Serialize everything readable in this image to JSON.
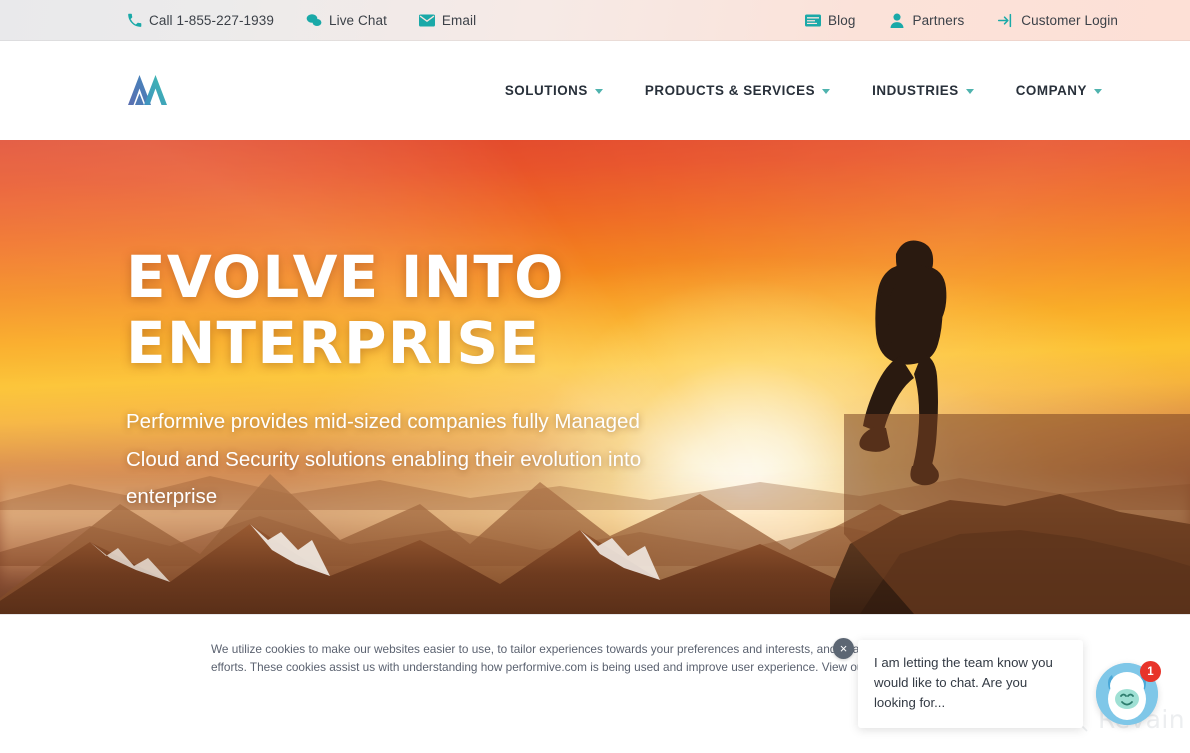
{
  "topbar": {
    "left_items": [
      {
        "icon": "phone-icon",
        "label": "Call 1-855-227-1939"
      },
      {
        "icon": "chat-bubbles-icon",
        "label": "Live Chat"
      },
      {
        "icon": "envelope-icon",
        "label": "Email"
      }
    ],
    "right_items": [
      {
        "icon": "blog-card-icon",
        "label": "Blog"
      },
      {
        "icon": "person-icon",
        "label": "Partners"
      },
      {
        "icon": "login-arrow-icon",
        "label": "Customer Login"
      }
    ],
    "accent_color": "#1aa9a8",
    "background_from": "#e9e9eb",
    "background_to": "#fde0d6"
  },
  "nav": {
    "logo_name": "performive-mountain-logo",
    "logo_colors": {
      "left": "#4a6fb5",
      "right": "#3fb6ad"
    },
    "items": [
      {
        "label": "SOLUTIONS",
        "has_dropdown": true
      },
      {
        "label": "PRODUCTS & SERVICES",
        "has_dropdown": true
      },
      {
        "label": "INDUSTRIES",
        "has_dropdown": true
      },
      {
        "label": "COMPANY",
        "has_dropdown": true
      }
    ],
    "caret_color": "#4fb3ae",
    "text_color": "#28303a"
  },
  "hero": {
    "headline_line1": "EVOLVE INTO",
    "headline_line2": "ENTERPRISE",
    "subtitle": "Performive provides mid-sized companies fully Managed Cloud and Security solutions enabling their evolution into enterprise",
    "image_description": "sunset-mountain-climber-photo",
    "headline_color": "#ffffff"
  },
  "cookie_banner": {
    "text_part1": "We utilize cookies to make our websites easier to use, to tailor experiences towards your preferences and interests, and to assist",
    "text_part2": "efforts. These cookies assist us with understanding how performive.com is being used and improve user experience. View our Co",
    "close_label": "×",
    "accept_button_color": "#2f6cb1"
  },
  "chat": {
    "message": "I am letting the team know you would like to chat. Are you looking for...",
    "badge_count": "1",
    "avatar_name": "yeti-chat-avatar",
    "badge_color": "#e8342a",
    "avatar_bg": "#7fc7e8"
  },
  "watermark": {
    "label": "Revain",
    "icon": "revain-magnifier-icon",
    "color": "#d4d8dc"
  }
}
